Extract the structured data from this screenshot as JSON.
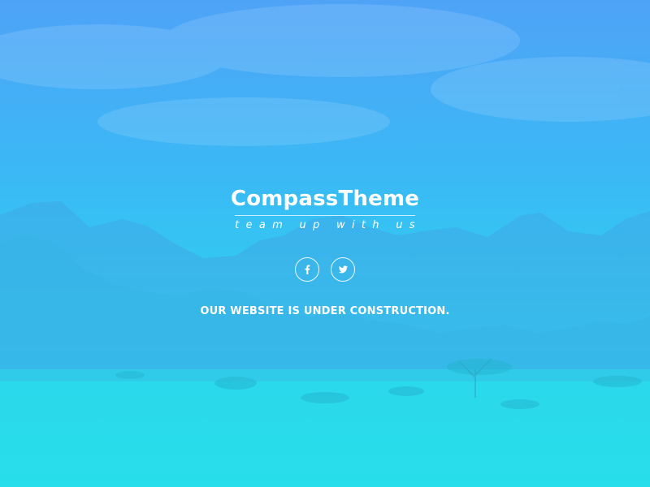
{
  "brand": {
    "title": "CompassTheme",
    "tagline": "team up with us"
  },
  "social": [
    {
      "icon": "facebook-icon",
      "label": "Facebook"
    },
    {
      "icon": "twitter-icon",
      "label": "Twitter"
    }
  ],
  "notice": "OUR WEBSITE IS UNDER CONSTRUCTION.",
  "colors": {
    "top": "#4fa3f7",
    "bottom": "#27e2ee",
    "text": "#ffffff"
  }
}
